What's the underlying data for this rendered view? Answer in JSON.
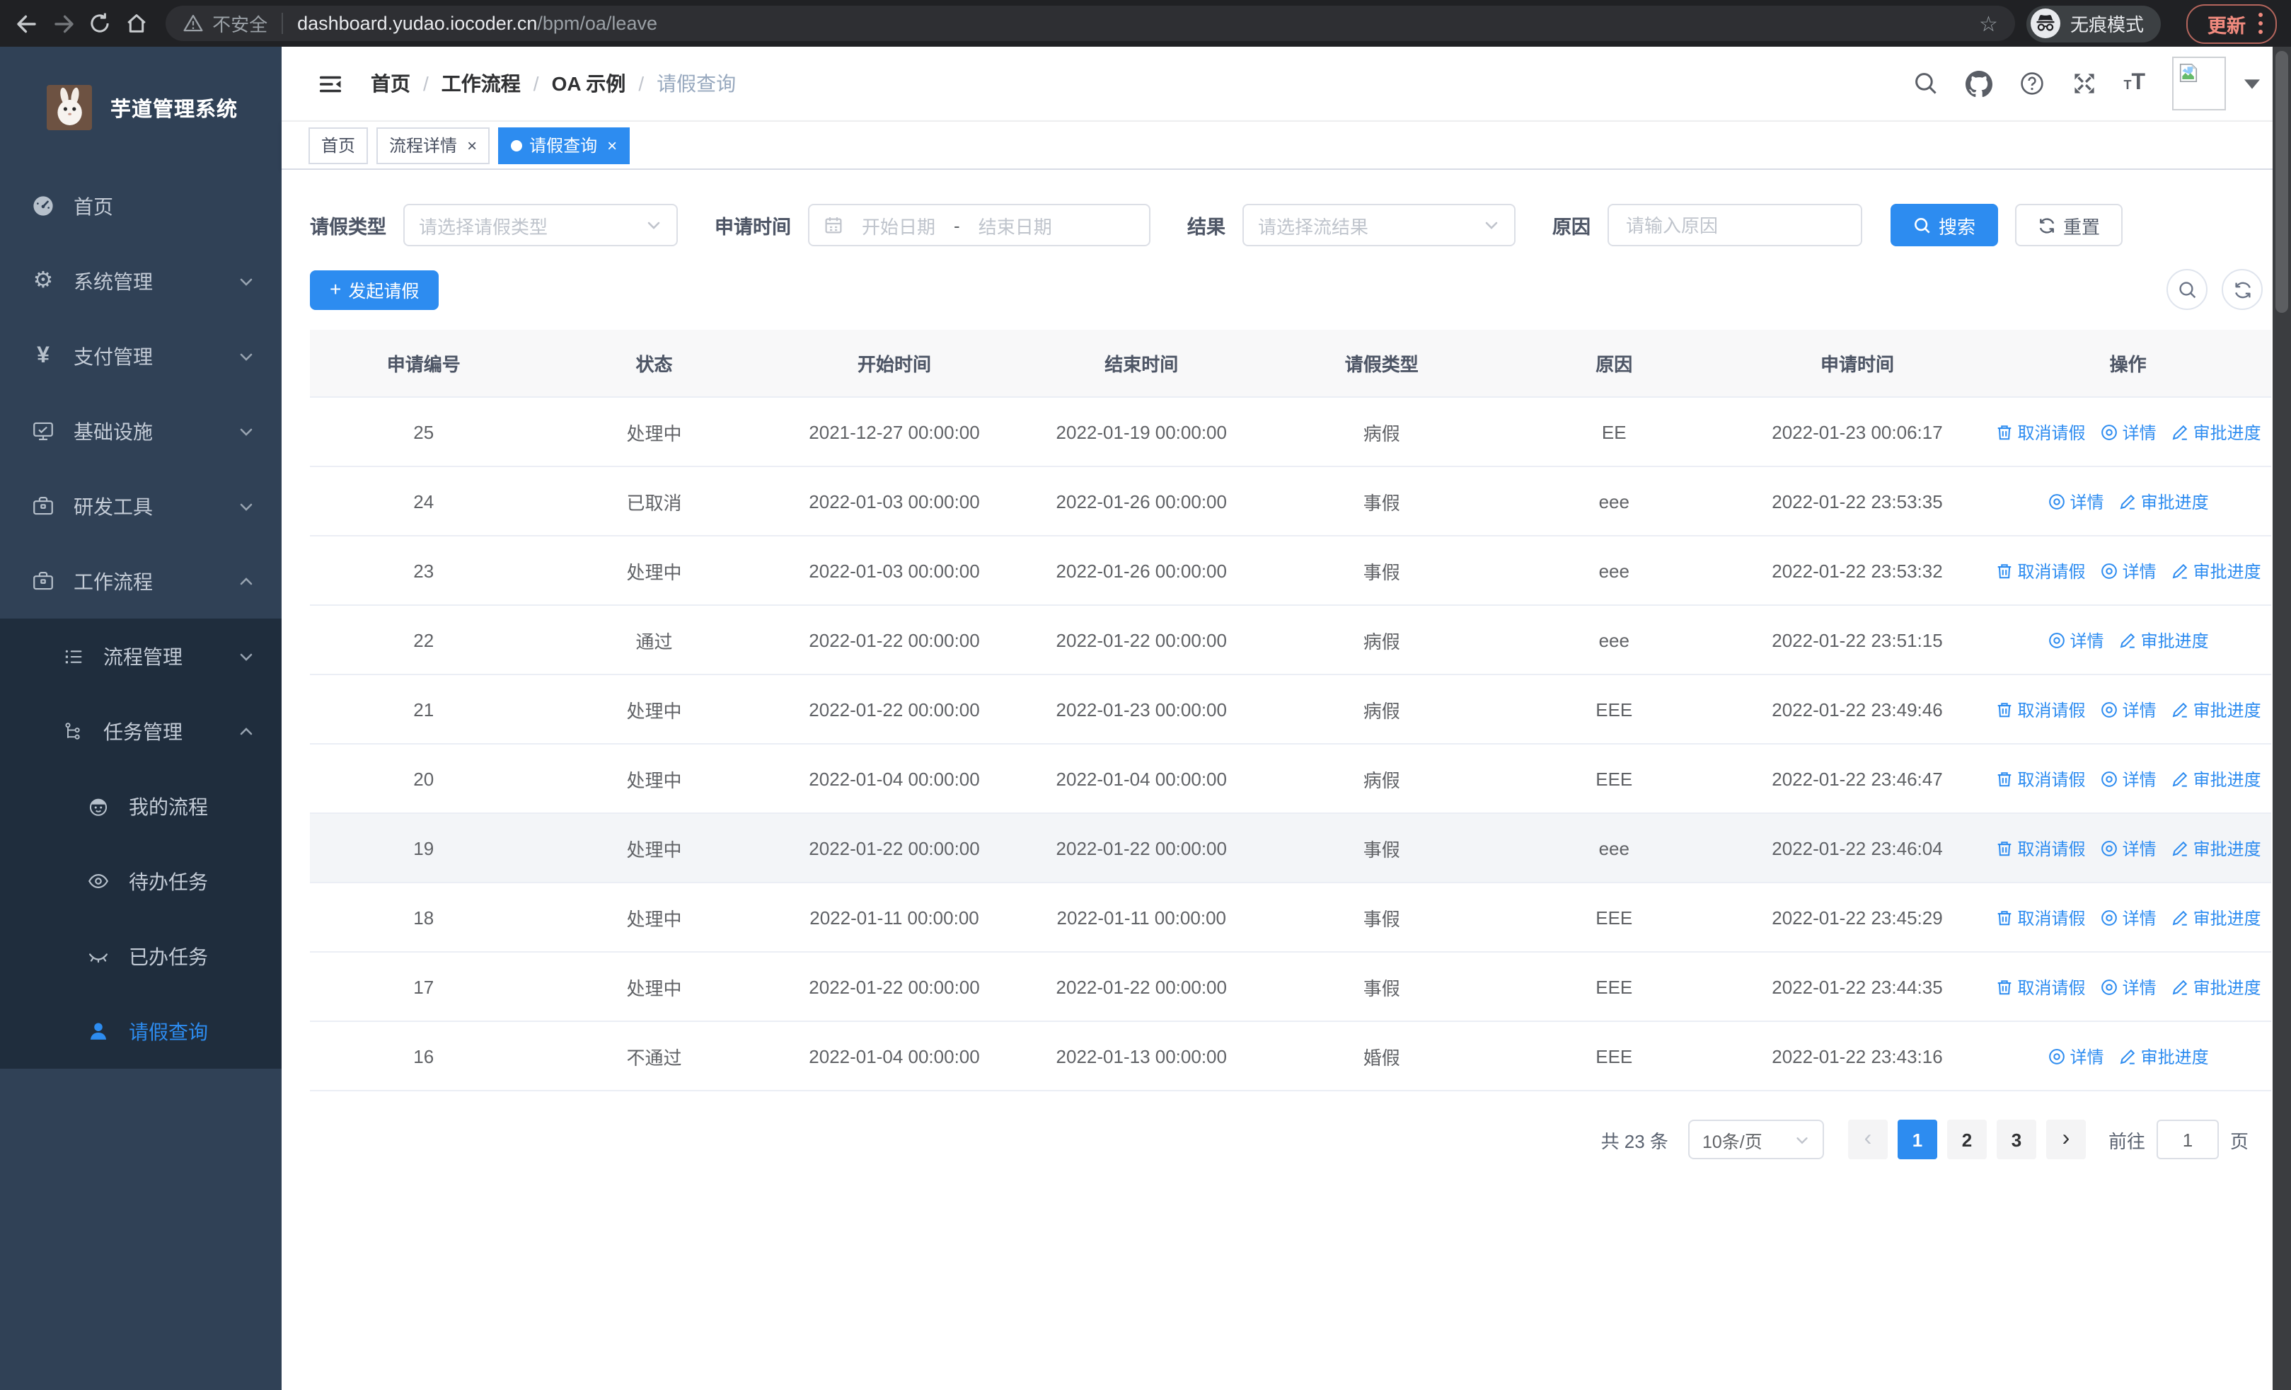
{
  "browser": {
    "security_label": "不安全",
    "url_host": "dashboard.yudao.iocoder.cn",
    "url_path": "/bpm/oa/leave",
    "incognito_label": "无痕模式",
    "update_label": "更新"
  },
  "sidebar": {
    "title": "芋道管理系统",
    "menu": [
      {
        "id": "home",
        "label": "首页",
        "icon": "dashboard-icon",
        "level": 0
      },
      {
        "id": "system-management",
        "label": "系统管理",
        "icon": "gear-icon",
        "level": 0,
        "chevron": "down"
      },
      {
        "id": "payment-management",
        "label": "支付管理",
        "icon": "yen-icon",
        "level": 0,
        "chevron": "down"
      },
      {
        "id": "infrastructure",
        "label": "基础设施",
        "icon": "monitor-icon",
        "level": 0,
        "chevron": "down"
      },
      {
        "id": "dev-tools",
        "label": "研发工具",
        "icon": "briefcase-icon",
        "level": 0,
        "chevron": "down"
      },
      {
        "id": "workflow",
        "label": "工作流程",
        "icon": "briefcase-icon",
        "level": 0,
        "chevron": "up"
      },
      {
        "id": "process-management",
        "label": "流程管理",
        "icon": "process-list-icon",
        "level": 1,
        "chevron": "down",
        "submenu": true
      },
      {
        "id": "task-management",
        "label": "任务管理",
        "icon": "task-tree-icon",
        "level": 1,
        "chevron": "up",
        "submenu": true
      },
      {
        "id": "my-process",
        "label": "我的流程",
        "icon": "face-icon",
        "level": 2,
        "submenu": true
      },
      {
        "id": "todo-tasks",
        "label": "待办任务",
        "icon": "eye-open-icon",
        "level": 2,
        "submenu": true
      },
      {
        "id": "done-tasks",
        "label": "已办任务",
        "icon": "eye-closed-icon",
        "level": 2,
        "submenu": true
      },
      {
        "id": "leave-query",
        "label": "请假查询",
        "icon": "user-icon",
        "level": 2,
        "submenu": true,
        "active": true
      }
    ]
  },
  "header": {
    "breadcrumb": [
      "首页",
      "工作流程",
      "OA 示例",
      "请假查询"
    ]
  },
  "tabs": [
    {
      "label": "首页",
      "closable": false,
      "active": false
    },
    {
      "label": "流程详情",
      "closable": true,
      "active": false
    },
    {
      "label": "请假查询",
      "closable": true,
      "active": true
    }
  ],
  "filters": {
    "leave_type": {
      "label": "请假类型",
      "placeholder": "请选择请假类型"
    },
    "apply_time": {
      "label": "申请时间",
      "start_placeholder": "开始日期",
      "separator": "-",
      "end_placeholder": "结束日期"
    },
    "result": {
      "label": "结果",
      "placeholder": "请选择流结果"
    },
    "reason": {
      "label": "原因",
      "placeholder": "请输入原因"
    },
    "search_label": "搜索",
    "reset_label": "重置"
  },
  "toolbar": {
    "create_label": "发起请假"
  },
  "table": {
    "columns": [
      "申请编号",
      "状态",
      "开始时间",
      "结束时间",
      "请假类型",
      "原因",
      "申请时间",
      "操作"
    ],
    "action_labels": {
      "cancel": "取消请假",
      "detail": "详情",
      "progress": "审批进度"
    },
    "rows": [
      {
        "id": "25",
        "status": "处理中",
        "start": "2021-12-27 00:00:00",
        "end": "2022-01-19 00:00:00",
        "type": "病假",
        "reason": "EE",
        "applied": "2022-01-23 00:06:17",
        "actions": [
          "cancel",
          "detail",
          "progress"
        ]
      },
      {
        "id": "24",
        "status": "已取消",
        "start": "2022-01-03 00:00:00",
        "end": "2022-01-26 00:00:00",
        "type": "事假",
        "reason": "eee",
        "applied": "2022-01-22 23:53:35",
        "actions": [
          "detail",
          "progress"
        ]
      },
      {
        "id": "23",
        "status": "处理中",
        "start": "2022-01-03 00:00:00",
        "end": "2022-01-26 00:00:00",
        "type": "事假",
        "reason": "eee",
        "applied": "2022-01-22 23:53:32",
        "actions": [
          "cancel",
          "detail",
          "progress"
        ]
      },
      {
        "id": "22",
        "status": "通过",
        "start": "2022-01-22 00:00:00",
        "end": "2022-01-22 00:00:00",
        "type": "病假",
        "reason": "eee",
        "applied": "2022-01-22 23:51:15",
        "actions": [
          "detail",
          "progress"
        ]
      },
      {
        "id": "21",
        "status": "处理中",
        "start": "2022-01-22 00:00:00",
        "end": "2022-01-23 00:00:00",
        "type": "病假",
        "reason": "EEE",
        "applied": "2022-01-22 23:49:46",
        "actions": [
          "cancel",
          "detail",
          "progress"
        ]
      },
      {
        "id": "20",
        "status": "处理中",
        "start": "2022-01-04 00:00:00",
        "end": "2022-01-04 00:00:00",
        "type": "病假",
        "reason": "EEE",
        "applied": "2022-01-22 23:46:47",
        "actions": [
          "cancel",
          "detail",
          "progress"
        ]
      },
      {
        "id": "19",
        "status": "处理中",
        "start": "2022-01-22 00:00:00",
        "end": "2022-01-22 00:00:00",
        "type": "事假",
        "reason": "eee",
        "applied": "2022-01-22 23:46:04",
        "actions": [
          "cancel",
          "detail",
          "progress"
        ],
        "highlight": true
      },
      {
        "id": "18",
        "status": "处理中",
        "start": "2022-01-11 00:00:00",
        "end": "2022-01-11 00:00:00",
        "type": "事假",
        "reason": "EEE",
        "applied": "2022-01-22 23:45:29",
        "actions": [
          "cancel",
          "detail",
          "progress"
        ]
      },
      {
        "id": "17",
        "status": "处理中",
        "start": "2022-01-22 00:00:00",
        "end": "2022-01-22 00:00:00",
        "type": "事假",
        "reason": "EEE",
        "applied": "2022-01-22 23:44:35",
        "actions": [
          "cancel",
          "detail",
          "progress"
        ]
      },
      {
        "id": "16",
        "status": "不通过",
        "start": "2022-01-04 00:00:00",
        "end": "2022-01-13 00:00:00",
        "type": "婚假",
        "reason": "EEE",
        "applied": "2022-01-22 23:43:16",
        "actions": [
          "detail",
          "progress"
        ]
      }
    ]
  },
  "pagination": {
    "total_label": "共 23 条",
    "page_size_value": "10条/页",
    "pages": [
      "1",
      "2",
      "3"
    ],
    "current_page": "1",
    "goto_label": "前往",
    "goto_value": "1",
    "page_unit_label": "页"
  },
  "colors": {
    "accent": "#2d8cf0",
    "sidebar_bg": "#304156",
    "submenu_bg": "#1f2d3d",
    "active_text": "#2d8cf0"
  }
}
